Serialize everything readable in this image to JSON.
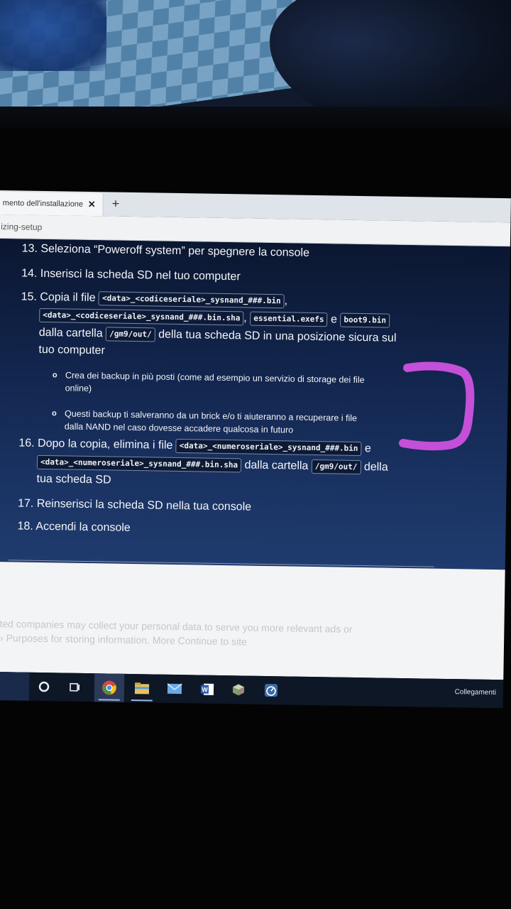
{
  "browser": {
    "tab_title": "mento dell'installazione",
    "tab_close": "✕",
    "new_tab": "+",
    "address": "izing-setup"
  },
  "steps": {
    "s13": "13. Seleziona “Poweroff system” per spegnere la console",
    "s14": "14. Inserisci la scheda SD nel tuo computer",
    "s15_prefix": "15. Copia il file",
    "s15_code1": "<data>_<codiceseriale>_sysnand_###.bin",
    "s15_comma1": ",",
    "s15_code2": "<data>_<codiceseriale>_sysnand_###.bin.sha",
    "s15_comma2": ",",
    "s15_code3": "essential.exefs",
    "s15_and": "e",
    "s15_code4": "boot9.bin",
    "s15_from": "dalla cartella",
    "s15_code5": "/gm9/out/",
    "s15_rest1": "della tua scheda SD in una posizione sicura sul",
    "s15_rest2": "tuo computer",
    "b1_line1": "Crea dei backup in più posti (come ad esempio un servizio di storage dei file",
    "b1_line2": "online)",
    "b2_line1": "Questi backup ti salveranno da un brick e/o ti aiuteranno a recuperare i file",
    "b2_line2": "dalla NAND nel caso dovesse accadere qualcosa in futuro",
    "s16_prefix": "16. Dopo la copia, elimina i file",
    "s16_code1": "<data>_<numeroseriale>_sysnand_###.bin",
    "s16_and": "e",
    "s16_code2": "<data>_<numeroseriale>_sysnand_###.bin.sha",
    "s16_from": "dalla cartella",
    "s16_code3": "/gm9/out/",
    "s16_della": "della",
    "s16_rest": "tua scheda SD",
    "s17": "17. Reinserisci la scheda SD nella tua console",
    "s18": "18. Accendi la console"
  },
  "cookie": {
    "line1": "cted companies may collect your personal data to serve you more relevant ads or",
    "line2": "› Purposes for storing information. More Continue to site"
  },
  "taskbar": {
    "icons": [
      "cortana-icon",
      "task-view-icon",
      "chrome-icon",
      "file-explorer-icon",
      "mail-icon",
      "word-icon",
      "app-box-icon",
      "speedometer-icon"
    ],
    "status": "Collegamenti"
  },
  "colors": {
    "page_bg": "#12254d",
    "annotation": "#c44fd8",
    "taskbar_bg": "#0e1726"
  }
}
